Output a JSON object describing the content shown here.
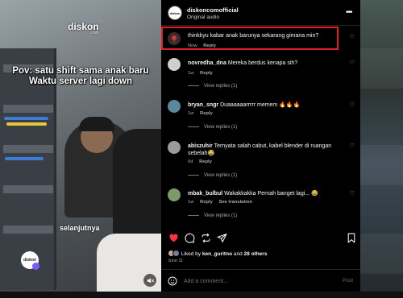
{
  "video": {
    "logo_text": "diskon",
    "logo_sub": ".com",
    "caption_line1": "Pov: satu shift sama anak baru",
    "caption_line2": "Waktu server lagi down",
    "next_label": "selanjutnya",
    "avatar_text": "diskon"
  },
  "header": {
    "username": "diskoncomofficial",
    "audio": "Original audio",
    "avatar_text": "diskon"
  },
  "comments": [
    {
      "username": "",
      "text": "thinkkyu kabar anak barunya sekarang gimana min?",
      "time": "Now",
      "reply": "Reply",
      "replies": ""
    },
    {
      "username": "novredha_dna",
      "text": "Mereka berdus kenapa sih?",
      "time": "1w",
      "reply": "Reply",
      "replies": "View replies (1)"
    },
    {
      "username": "bryan_sngr",
      "text": "Duaaaaaarrrrr memem 🔥🔥🔥",
      "time": "1w",
      "reply": "Reply",
      "replies": "View replies (1)"
    },
    {
      "username": "abiszuhir",
      "text": "Ternyata salah cabut, kabel blender di ruangan sebelah😂",
      "time": "6d",
      "reply": "Reply",
      "replies": "View replies (1)"
    },
    {
      "username": "mbak_bulbul",
      "text": "Wakakkakka Pernah banget lagi... 😂",
      "time": "1w",
      "reply": "Reply",
      "translation": "See translation",
      "replies": "View replies (1)"
    }
  ],
  "footer": {
    "liked_prefix": "Liked by",
    "liked_user": "ken_guritno",
    "liked_and": "and",
    "liked_others": "28 others",
    "date": "June 11",
    "add_comment_placeholder": "Add a comment…",
    "post_label": "Post"
  },
  "colors": {
    "like_red": "#ff3040",
    "highlight_border": "#e0202a",
    "panel_bg": "#000000",
    "muted_text": "#a8a8a8"
  },
  "icons": [
    "heart-icon",
    "comment-icon",
    "repost-icon",
    "share-icon",
    "bookmark-icon",
    "emoji-icon",
    "more-icon",
    "mute-icon"
  ]
}
